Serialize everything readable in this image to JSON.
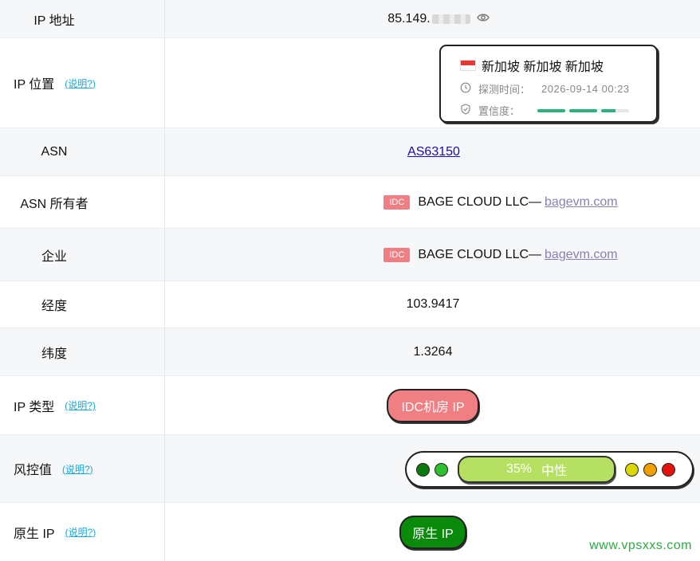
{
  "rows": {
    "ip": {
      "label": "IP 地址",
      "value": "85.149."
    },
    "location": {
      "label": "IP 位置",
      "explain": "(说明?)",
      "place": "新加坡 新加坡 新加坡",
      "detect_label": "探测时间：",
      "detect_time": "2026-09-14 00:23",
      "confidence_label": "置信度：",
      "confidence_fill": [
        1.0,
        1.0,
        0.5
      ]
    },
    "asn": {
      "label": "ASN",
      "value": "AS63150"
    },
    "asn_owner": {
      "label": "ASN 所有者",
      "badge": "IDC",
      "name": "BAGE CLOUD LLC",
      "dash": "—",
      "domain": "bagevm.com"
    },
    "company": {
      "label": "企业",
      "badge": "IDC",
      "name": "BAGE CLOUD LLC",
      "dash": "—",
      "domain": "bagevm.com"
    },
    "longitude": {
      "label": "经度",
      "value": "103.9417"
    },
    "latitude": {
      "label": "纬度",
      "value": "1.3264"
    },
    "ip_type": {
      "label": "IP 类型",
      "explain": "(说明?)",
      "value": "IDC机房 IP"
    },
    "risk": {
      "label": "风控值",
      "explain": "(说明?)",
      "percent": "35%",
      "level": "中性",
      "left_dots": [
        "#0a7a0a",
        "#2ec02e"
      ],
      "right_dots": [
        "#d9d900",
        "#f0a000",
        "#e8120c"
      ]
    },
    "native": {
      "label": "原生 IP",
      "explain": "(说明?)",
      "value": "原生 IP"
    }
  },
  "colors": {
    "idc_badge": "#ef7f82",
    "link": "#1a0dab",
    "confidence_fill": "#2ab27b",
    "risk_bar": "#b5e061",
    "native_pill": "#0a8a0a"
  },
  "watermark": "www.vpsxxs.com"
}
